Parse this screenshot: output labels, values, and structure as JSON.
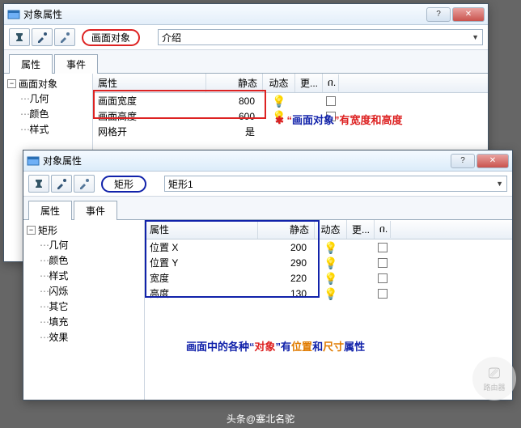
{
  "win1": {
    "title": "对象属性",
    "object_label": "画面对象",
    "combo_value": "介绍",
    "tabs": {
      "props": "属性",
      "events": "事件"
    },
    "tree": {
      "root": "画面对象",
      "children": [
        "几何",
        "颜色",
        "样式"
      ]
    },
    "headers": {
      "attr": "属性",
      "static": "静态",
      "dyn": "动态",
      "more": "更... ",
      "lock": "በ."
    },
    "rows": [
      {
        "attr": "画面宽度",
        "static": "800"
      },
      {
        "attr": "画面高度",
        "static": "600"
      },
      {
        "attr": "网格开",
        "static": "是"
      }
    ],
    "annotation": {
      "q1": "“",
      "m1": "画面对象",
      "q2": "”",
      "tail": "有宽度和高度"
    }
  },
  "win2": {
    "title": "对象属性",
    "object_label": "矩形",
    "combo_value": "矩形1",
    "tabs": {
      "props": "属性",
      "events": "事件"
    },
    "tree": {
      "root": "矩形",
      "children": [
        "几何",
        "颜色",
        "样式",
        "闪烁",
        "其它",
        "填充",
        "效果"
      ]
    },
    "headers": {
      "attr": "属性",
      "static": "静态",
      "dyn": "动态",
      "more": "更... ",
      "lock": "በ."
    },
    "rows": [
      {
        "attr": "位置 X",
        "static": "200"
      },
      {
        "attr": "位置 Y",
        "static": "290"
      },
      {
        "attr": "宽度",
        "static": "220"
      },
      {
        "attr": "高度",
        "static": "130"
      }
    ],
    "annotation": {
      "a": "画面中的各种",
      "q1": "“",
      "b": "对象",
      "q2": "”",
      "c": "有",
      "d": "位置",
      "e": "和",
      "f": "尺寸",
      "g": "属性"
    }
  },
  "watermark": "路由器",
  "credit": "头条@塞北名驼",
  "chart_data": {
    "type": "table",
    "tables": [
      {
        "title": "画面对象",
        "columns": [
          "属性",
          "静态"
        ],
        "rows": [
          [
            "画面宽度",
            800
          ],
          [
            "画面高度",
            600
          ],
          [
            "网格开",
            "是"
          ]
        ]
      },
      {
        "title": "矩形",
        "columns": [
          "属性",
          "静态"
        ],
        "rows": [
          [
            "位置 X",
            200
          ],
          [
            "位置 Y",
            290
          ],
          [
            "宽度",
            220
          ],
          [
            "高度",
            130
          ]
        ]
      }
    ]
  }
}
